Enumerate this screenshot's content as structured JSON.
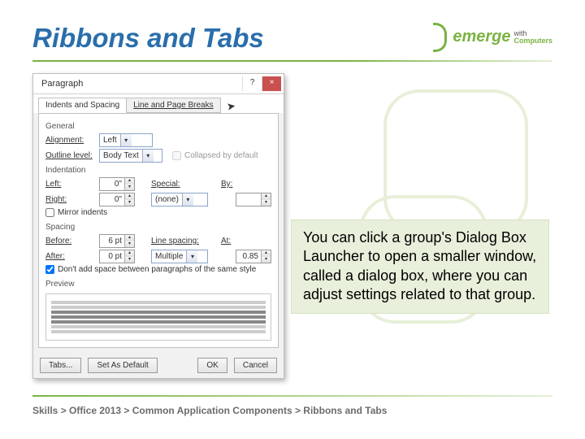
{
  "header": {
    "title": "Ribbons and Tabs",
    "logo_text": "emerge",
    "logo_sub_with": "with",
    "logo_sub_comp": "Computers"
  },
  "dialog": {
    "title": "Paragraph",
    "help": "?",
    "close": "×",
    "tabs": {
      "active": "Indents and Spacing",
      "other": "Line and Page Breaks"
    },
    "general": {
      "label": "General",
      "alignment_lbl": "Alignment:",
      "alignment_val": "Left",
      "outline_lbl": "Outline level:",
      "outline_val": "Body Text",
      "collapsed": "Collapsed by default"
    },
    "indent": {
      "label": "Indentation",
      "left_lbl": "Left:",
      "left_val": "0\"",
      "right_lbl": "Right:",
      "right_val": "0\"",
      "special_lbl": "Special:",
      "special_val": "(none)",
      "by_lbl": "By:",
      "mirror": "Mirror indents"
    },
    "spacing": {
      "label": "Spacing",
      "before_lbl": "Before:",
      "before_val": "6 pt",
      "after_lbl": "After:",
      "after_val": "0 pt",
      "line_lbl": "Line spacing:",
      "line_val": "Multiple",
      "at_lbl": "At:",
      "at_val": "0.85",
      "dont_add": "Don't add space between paragraphs of the same style"
    },
    "preview_lbl": "Preview",
    "buttons": {
      "tabs": "Tabs...",
      "def": "Set As Default",
      "ok": "OK",
      "cancel": "Cancel"
    }
  },
  "callout": "You can click a group's Dialog Box Launcher to open a smaller window, called a dialog box, where you can adjust settings related to that group.",
  "footer": "Skills > Office 2013 > Common Application Components > Ribbons and Tabs"
}
